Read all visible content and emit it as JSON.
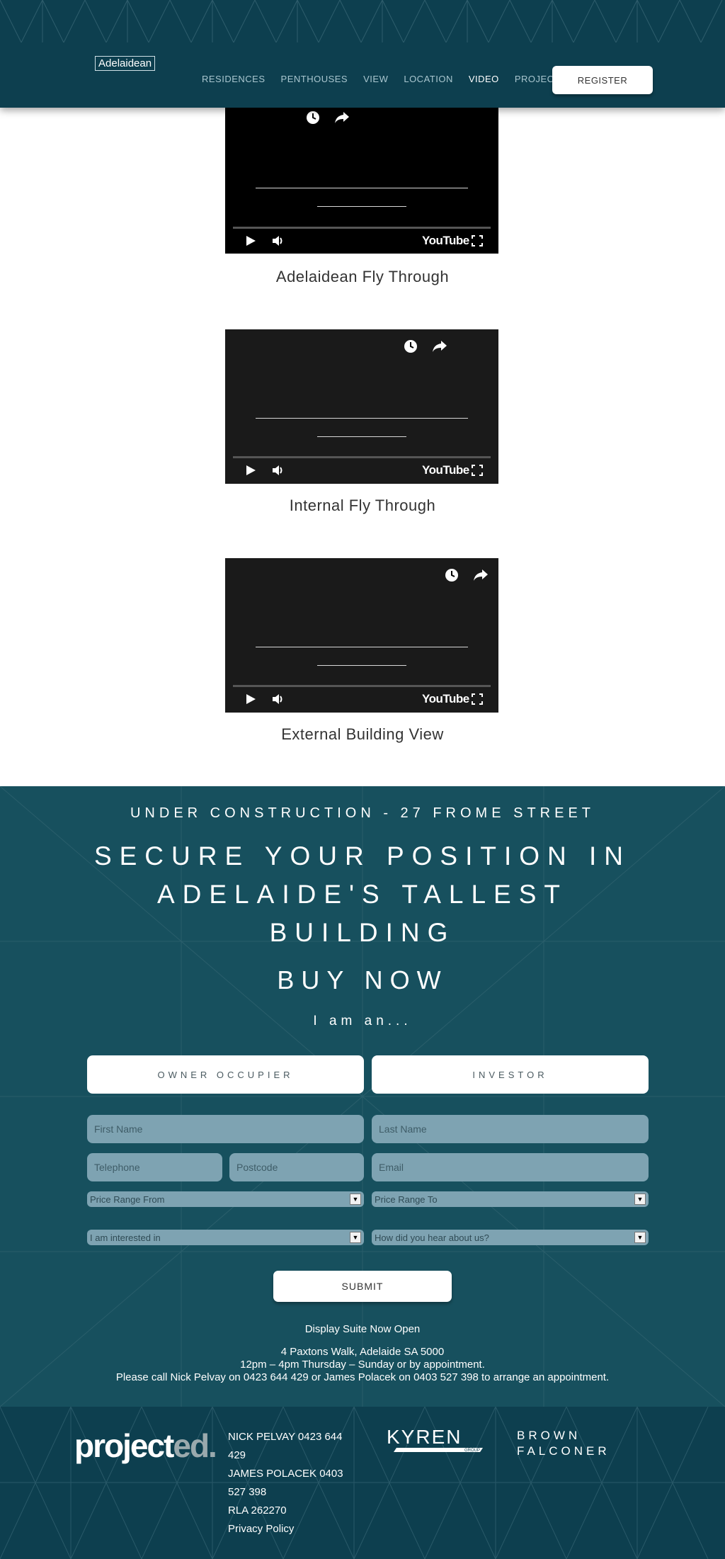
{
  "header": {
    "logo": "Adelaidean",
    "nav": [
      "RESIDENCES",
      "PENTHOUSES",
      "VIEW",
      "LOCATION",
      "VIDEO",
      "PROJECT"
    ],
    "active": "VIDEO",
    "register": "REGISTER"
  },
  "videos": [
    {
      "caption": "Adelaidean Fly Through",
      "brand": "YouTube"
    },
    {
      "caption": "Internal Fly Through",
      "brand": "YouTube"
    },
    {
      "caption": "External Building View",
      "brand": "YouTube"
    }
  ],
  "form_section": {
    "under_construction": "UNDER CONSTRUCTION -  27 FROME STREET",
    "headline": "SECURE YOUR POSITION IN ADELAIDE'S TALLEST BUILDING",
    "buy_now": "BUY NOW",
    "i_am": "I am an...",
    "owner": "OWNER OCCUPIER",
    "investor": "INVESTOR",
    "first_name": "First Name",
    "last_name": "Last Name",
    "telephone": "Telephone",
    "postcode": "Postcode",
    "email": "Email",
    "price_from": "Price Range From",
    "price_to": "Price Range To",
    "interested": "I am interested in",
    "hear": "How did you hear about us?",
    "submit": "SUBMIT",
    "display_suite": "Display Suite Now Open",
    "address": "4 Paxtons Walk, Adelaide SA 5000",
    "hours": "12pm – 4pm Thursday – Sunday or by appointment.",
    "call": "Please call Nick Pelvay on 0423 644 429 or James Polacek on 0403 527 398 to arrange an appointment."
  },
  "footer": {
    "brand_main": "project",
    "brand_suffix": "ed.",
    "contact_1": "NICK PELVAY   0423 644 429",
    "contact_2": "JAMES POLACEK   0403 527 398",
    "rla": "RLA 262270",
    "privacy": "Privacy Policy",
    "kyren": "KYREN",
    "kyren_sub": "GROUP",
    "brown_1": "BROWN",
    "brown_2": "FALCONER"
  }
}
